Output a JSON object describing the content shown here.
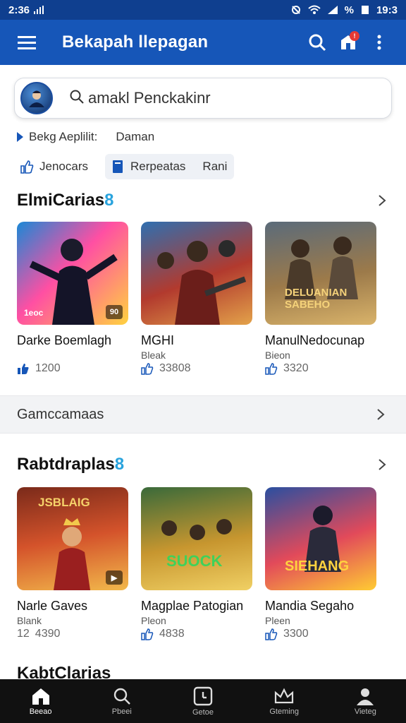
{
  "status_bar": {
    "time": "2:36",
    "signal_text": "%",
    "battery_text": "19:3"
  },
  "app_bar": {
    "title": "Bekapah llepagan",
    "notification_count": "!"
  },
  "search": {
    "placeholder": "amakl Penckakinr"
  },
  "crumb": {
    "first": "Bekg Aeplilit:",
    "second": "Daman"
  },
  "chips": [
    {
      "label": "Jenocars",
      "icon": "thumb-up-icon"
    },
    {
      "label": "Rerpeatas",
      "label2": "Rani",
      "icon": "book-icon"
    }
  ],
  "sections": [
    {
      "title": "ElmiCarias",
      "suffix": "8",
      "cards": [
        {
          "name": "Darke Boemlagh",
          "sub": "",
          "count": "1200",
          "thumb_tag": "1eoc",
          "corner": "90",
          "colors": [
            "#1a88d6",
            "#ff4fa3",
            "#ffd23f"
          ]
        },
        {
          "name": "MGHI",
          "sub": "Bleak",
          "count": "33808",
          "thumb_tag": "",
          "corner": "",
          "colors": [
            "#2f6fb0",
            "#b23a2e",
            "#e3a24a"
          ]
        },
        {
          "name": "ManulNedocunap",
          "sub": "Bieon",
          "count": "3320",
          "thumb_tag": "DELUANIAN SABEHO",
          "corner": "",
          "colors": [
            "#5b6b7a",
            "#9c7a4a",
            "#d9b36a"
          ]
        }
      ]
    },
    {
      "title": "Rabtdraplas",
      "suffix": "8",
      "cards": [
        {
          "name": "Narle Gaves",
          "sub": "Blank",
          "count": "4390",
          "count_prefix": "12",
          "thumb_tag": "JSBLAIG",
          "corner": "▶",
          "colors": [
            "#7a2a1a",
            "#d4532b",
            "#f2b84b"
          ]
        },
        {
          "name": "Magplae Patogian",
          "sub": "Pleon",
          "count": "4838",
          "thumb_tag": "SUOCK",
          "corner": "",
          "colors": [
            "#3a6a3a",
            "#c7962f",
            "#f0d064"
          ]
        },
        {
          "name": "Mandia Segaho",
          "sub": "Pleen",
          "count": "3300",
          "thumb_tag": "SIEHANG",
          "corner": "",
          "colors": [
            "#2a4fa0",
            "#e24a5a",
            "#ffcc33"
          ]
        }
      ]
    }
  ],
  "band": {
    "title": "Gamccamaas"
  },
  "peek": {
    "title": "KabtClarias"
  },
  "bottom_nav": [
    {
      "label": "Beeao",
      "icon": "home-icon",
      "active": true
    },
    {
      "label": "Pbeei",
      "icon": "search-icon",
      "active": false
    },
    {
      "label": "Getoe",
      "icon": "library-icon",
      "active": false
    },
    {
      "label": "Gteming",
      "icon": "crown-icon",
      "active": false
    },
    {
      "label": "Vieteg",
      "icon": "person-icon",
      "active": false
    }
  ]
}
